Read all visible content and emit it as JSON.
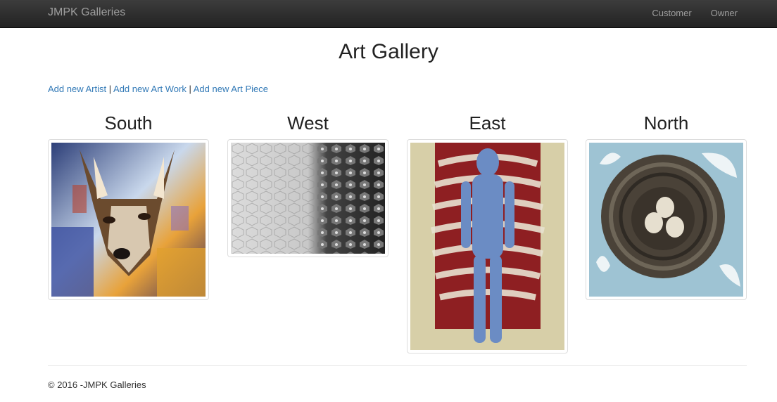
{
  "navbar": {
    "brand": "JMPK Galleries",
    "links": [
      "Customer",
      "Owner"
    ],
    "background": "#222222"
  },
  "page": {
    "title": "Art Gallery"
  },
  "actions": {
    "add_artist": "Add new Artist",
    "add_art_work": "Add new Art Work",
    "add_art_piece": "Add new Art Piece",
    "separator": "|"
  },
  "regions": [
    {
      "name": "South",
      "image_icon": "wolf-painting-image"
    },
    {
      "name": "West",
      "image_icon": "hexagon-pattern-image"
    },
    {
      "name": "East",
      "image_icon": "ribcage-figure-image"
    },
    {
      "name": "North",
      "image_icon": "bird-nest-image"
    }
  ],
  "footer": {
    "text": "© 2016 -JMPK Galleries"
  },
  "colors": {
    "link": "#337ab7",
    "text": "#333333"
  }
}
